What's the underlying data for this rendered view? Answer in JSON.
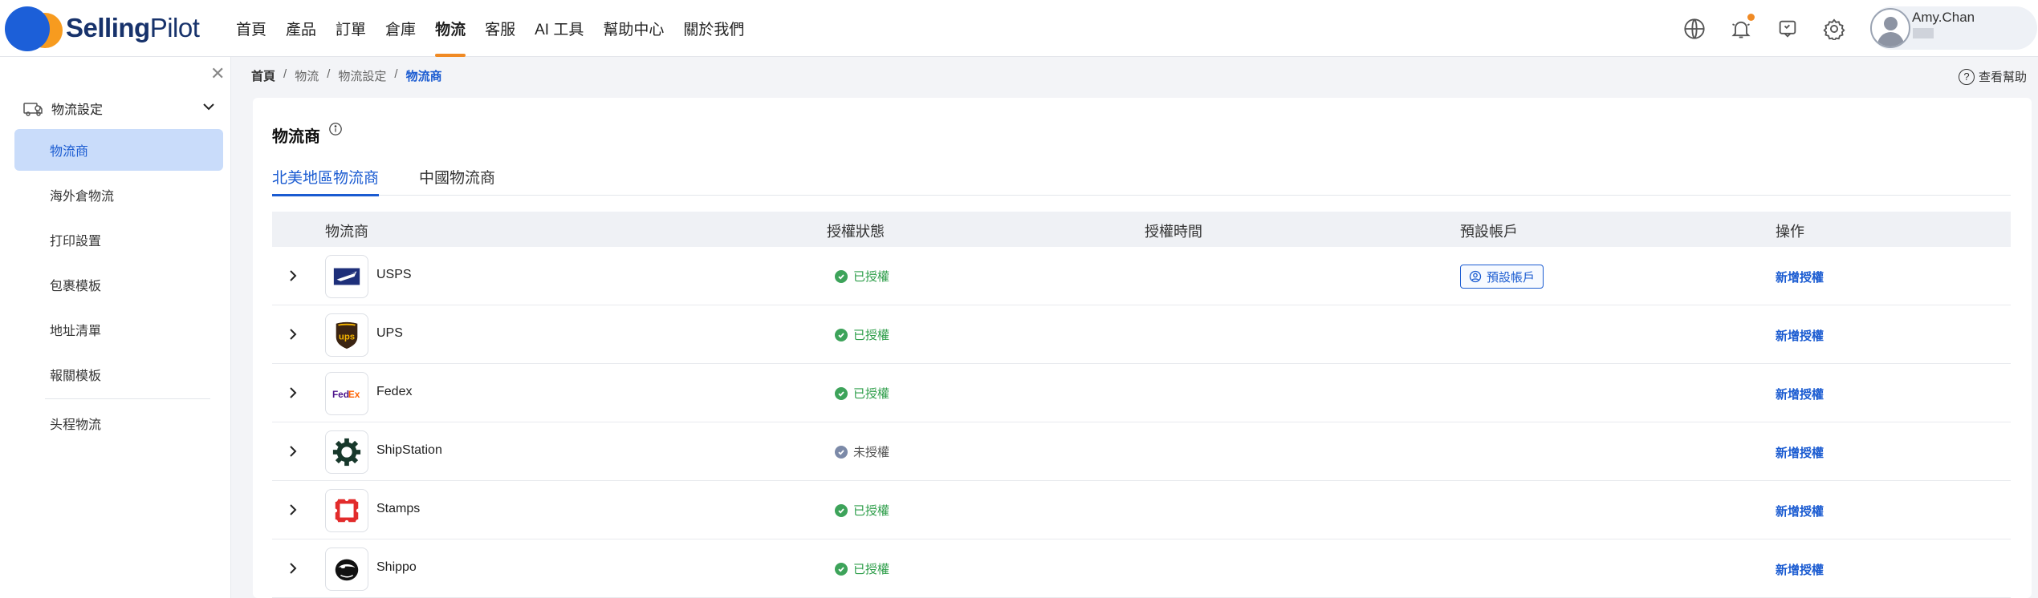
{
  "app": {
    "logo_bold": "Selling",
    "logo_light": "Pilot"
  },
  "nav": {
    "items": [
      {
        "label": "首頁"
      },
      {
        "label": "產品"
      },
      {
        "label": "訂單"
      },
      {
        "label": "倉庫"
      },
      {
        "label": "物流",
        "active": true
      },
      {
        "label": "客服"
      },
      {
        "label": "AI 工具"
      },
      {
        "label": "幫助中心"
      },
      {
        "label": "關於我們"
      }
    ]
  },
  "header_icons": [
    "globe-icon",
    "bell-icon",
    "message-icon",
    "gear-icon"
  ],
  "user": {
    "name": "Amy.Chan"
  },
  "sidebar": {
    "group_label": "物流設定",
    "items": [
      {
        "label": "物流商",
        "active": true
      },
      {
        "label": "海外倉物流"
      },
      {
        "label": "打印設置"
      },
      {
        "label": "包裹模板"
      },
      {
        "label": "地址清單"
      },
      {
        "label": "報關模板"
      },
      {
        "label": "头程物流"
      }
    ]
  },
  "breadcrumb": [
    "首頁",
    "物流",
    "物流設定",
    "物流商"
  ],
  "help_label": "查看幫助",
  "page_title": "物流商",
  "tabs": [
    {
      "label": "北美地區物流商",
      "active": true
    },
    {
      "label": "中國物流商"
    }
  ],
  "table": {
    "columns": [
      "物流商",
      "授權狀態",
      "授權時間",
      "預設帳戶",
      "操作"
    ],
    "rows": [
      {
        "name": "USPS",
        "logo": "usps-eagle-logo",
        "status": "已授權",
        "authorized": true,
        "default_account": "預設帳戶",
        "action": "新增授權"
      },
      {
        "name": "UPS",
        "logo": "ups-shield-logo",
        "status": "已授權",
        "authorized": true,
        "default_account": "",
        "action": "新增授權"
      },
      {
        "name": "Fedex",
        "logo": "fedex-logo",
        "status": "已授權",
        "authorized": true,
        "default_account": "",
        "action": "新增授權"
      },
      {
        "name": "ShipStation",
        "logo": "shipstation-gear-logo",
        "status": "未授權",
        "authorized": false,
        "default_account": "",
        "action": "新增授權"
      },
      {
        "name": "Stamps",
        "logo": "stamps-logo",
        "status": "已授權",
        "authorized": true,
        "default_account": "",
        "action": "新增授權"
      },
      {
        "name": "Shippo",
        "logo": "shippo-logo",
        "status": "已授權",
        "authorized": true,
        "default_account": "",
        "action": "新增授權"
      }
    ]
  },
  "colors": {
    "accent_blue": "#1a5bd1",
    "nav_underline": "#f08a24",
    "status_ok": "#3da35a",
    "status_pending": "#7c8aa8"
  }
}
